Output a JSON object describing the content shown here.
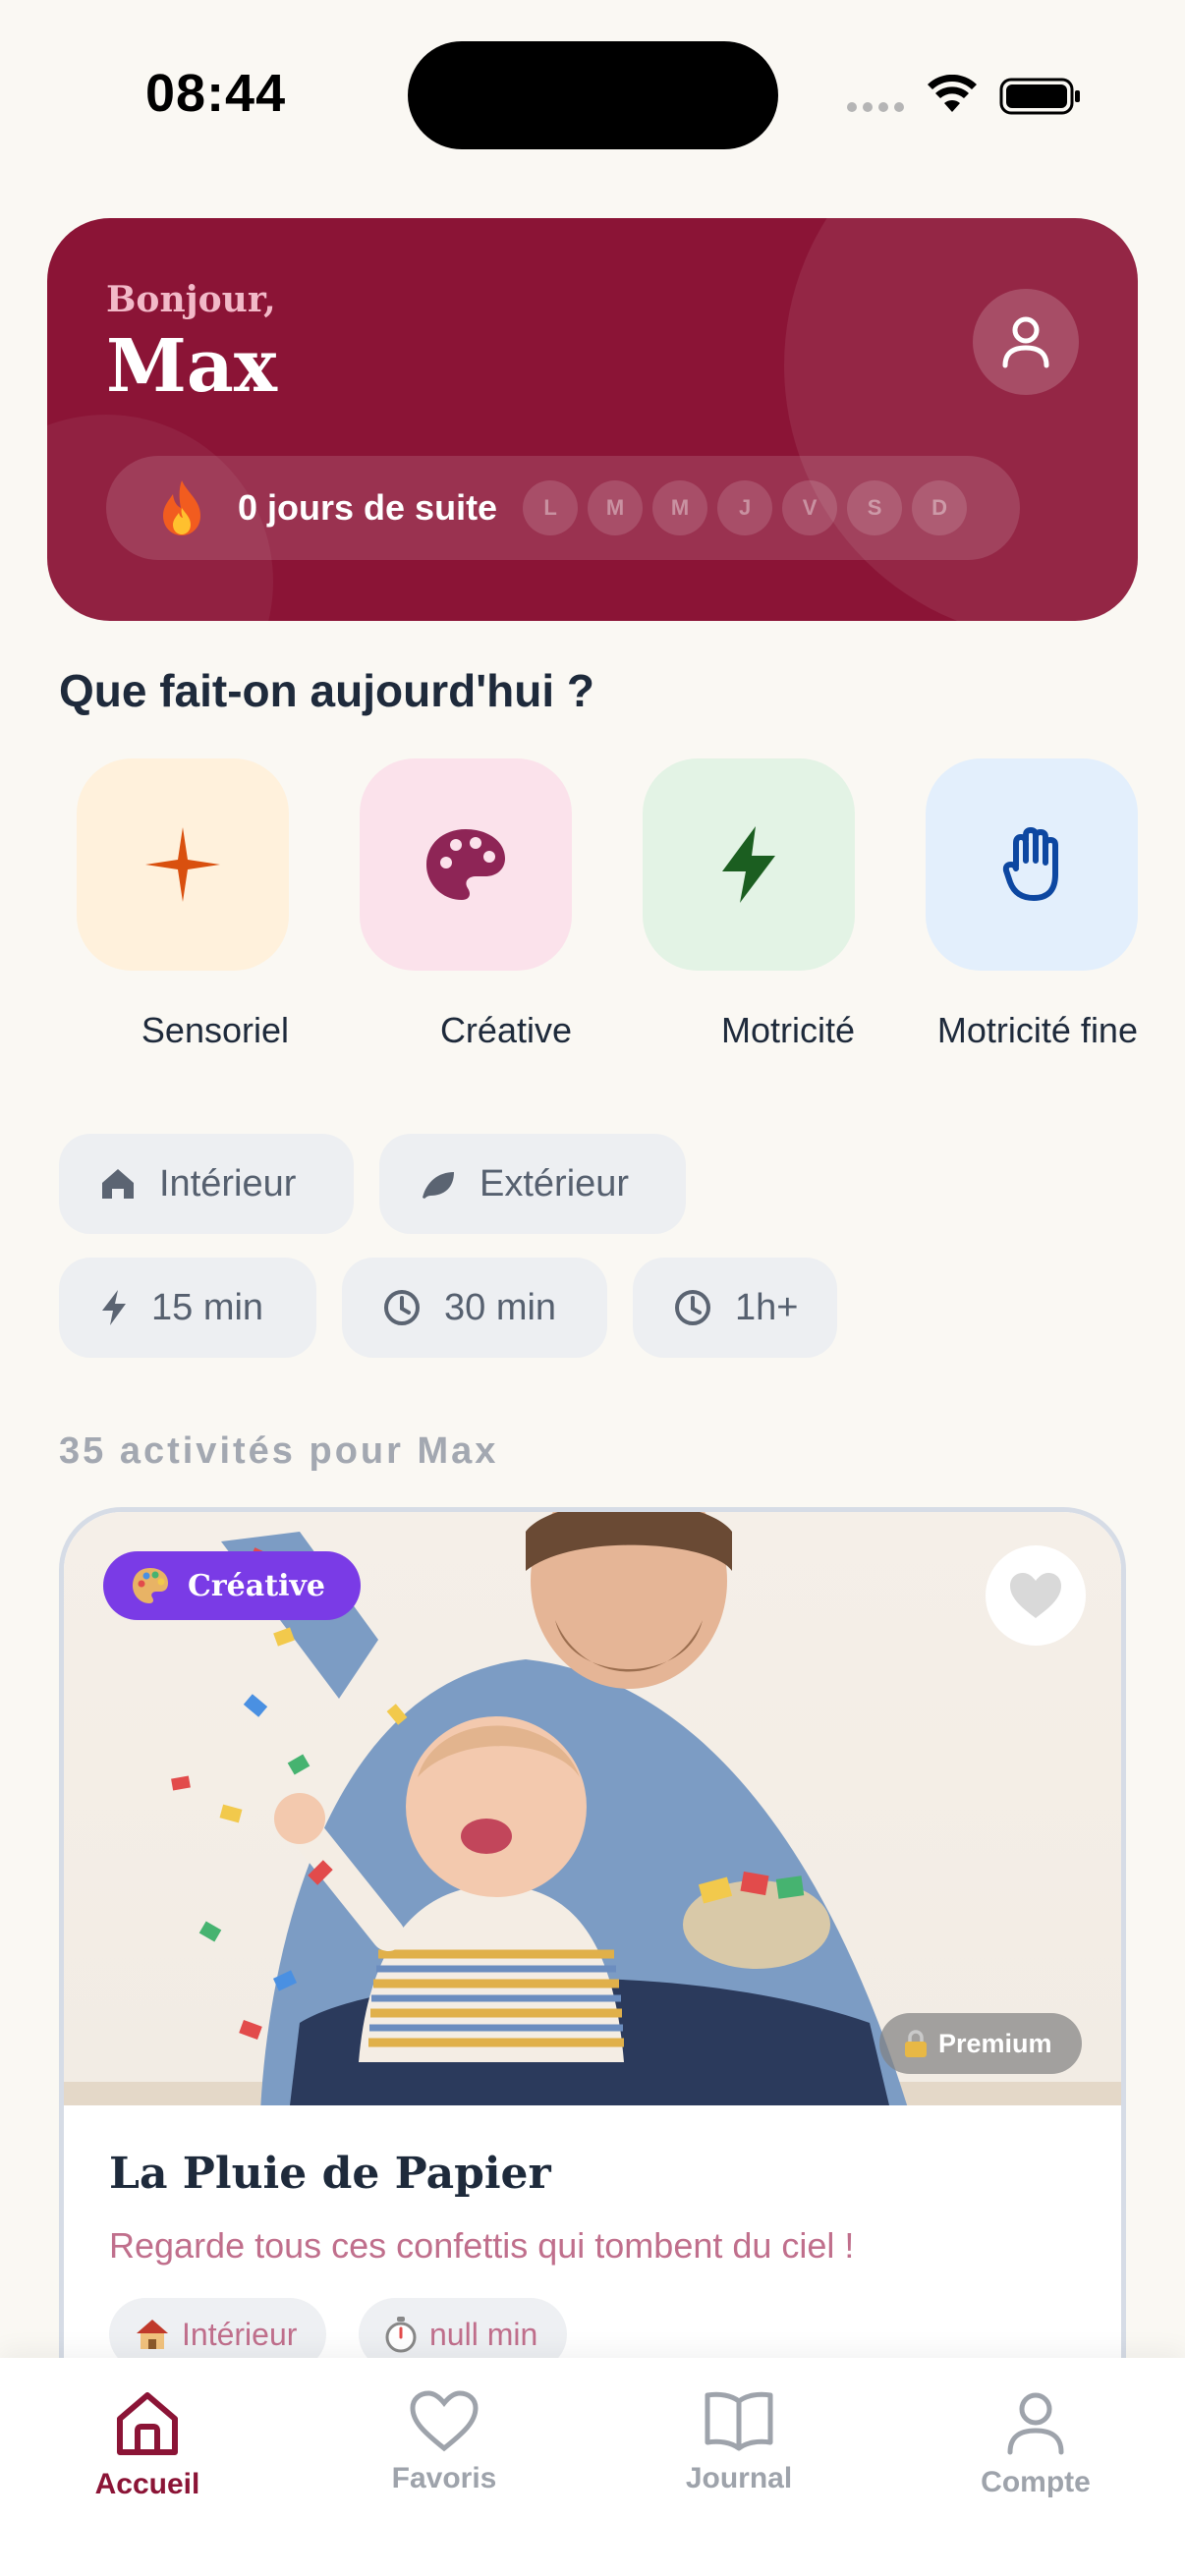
{
  "status_bar": {
    "time": "08:44"
  },
  "header": {
    "greeting": "Bonjour,",
    "name": "Max",
    "streak_text": "0 jours de suite",
    "days": [
      "L",
      "M",
      "M",
      "J",
      "V",
      "S",
      "D"
    ]
  },
  "section_title": "Que fait-on aujourd'hui ?",
  "categories": [
    {
      "label": "Sensoriel",
      "icon": "sparkle-icon",
      "bg": "#FFF1DC",
      "color": "#D9500F"
    },
    {
      "label": "Créative",
      "icon": "palette-icon",
      "bg": "#FBE2EB",
      "color": "#8E2556"
    },
    {
      "label": "Motricité",
      "icon": "lightning-icon",
      "bg": "#E3F3E5",
      "color": "#1B5E20"
    },
    {
      "label": "Motricité fine",
      "icon": "hand-icon",
      "bg": "#E3EFFC",
      "color": "#0D47A1"
    }
  ],
  "filters": {
    "location": [
      {
        "label": "Intérieur",
        "icon": "home-icon"
      },
      {
        "label": "Extérieur",
        "icon": "leaf-icon"
      }
    ],
    "duration": [
      {
        "label": "15 min",
        "icon": "lightning-icon"
      },
      {
        "label": "30 min",
        "icon": "clock-icon"
      },
      {
        "label": "1h+",
        "icon": "clock-icon"
      }
    ]
  },
  "activity_count_text": "35 activités pour Max",
  "activity": {
    "category_badge": "Créative",
    "premium_label": "Premium",
    "title": "La Pluie de Papier",
    "subtitle": "Regarde tous ces confettis qui tombent du ciel !",
    "tags": [
      {
        "label": "Intérieur",
        "icon": "house-emoji-icon"
      },
      {
        "label": "null min",
        "icon": "stopwatch-emoji-icon"
      }
    ]
  },
  "nav": {
    "items": [
      {
        "label": "Accueil",
        "icon": "home-icon",
        "active": true
      },
      {
        "label": "Favoris",
        "icon": "heart-icon",
        "active": false
      },
      {
        "label": "Journal",
        "icon": "book-icon",
        "active": false
      },
      {
        "label": "Compte",
        "icon": "user-icon",
        "active": false
      }
    ]
  },
  "colors": {
    "brand": "#8B1436",
    "badge_purple": "#7A3BE6",
    "background": "#FAF8F3"
  }
}
